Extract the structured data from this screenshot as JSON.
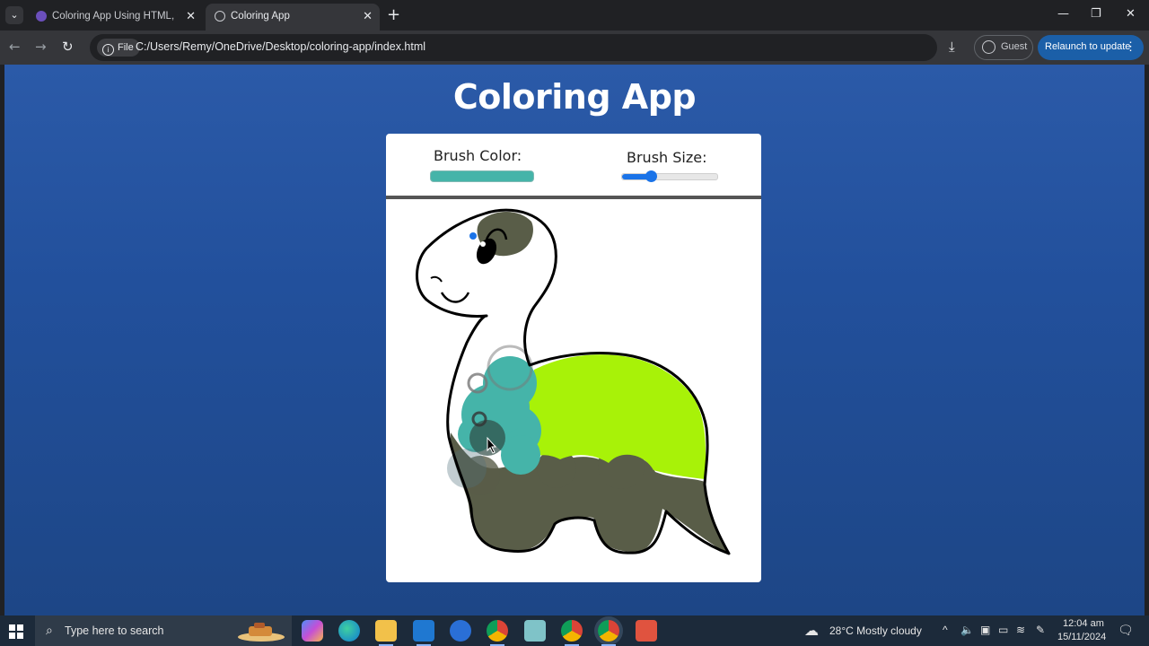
{
  "browser": {
    "tabs": [
      {
        "title": "Coloring App Using HTML, CSS",
        "favicon": "app-favicon-icon",
        "active": false
      },
      {
        "title": "Coloring App",
        "favicon": "globe-icon",
        "active": true
      }
    ],
    "new_tab_label": "+",
    "address": {
      "chip_label": "File",
      "url": "C:/Users/Remy/OneDrive/Desktop/coloring-app/index.html"
    },
    "guest_label": "Guest",
    "relaunch_label": "Relaunch to update"
  },
  "app": {
    "title": "Coloring App",
    "brush_color_label": "Brush Color:",
    "brush_color_value": "#45b4a9",
    "brush_size_label": "Brush Size:",
    "brush_size_fraction": 0.3
  },
  "colors": {
    "teal": "#45b4a9",
    "lime": "#a8f208",
    "olive": "#595d48",
    "accent_blue": "#1a73e8"
  },
  "taskbar": {
    "search_placeholder": "Type here to search",
    "apps": [
      "copilot-icon",
      "edge-icon",
      "file-explorer-icon",
      "vscode-icon",
      "app-store-icon",
      "chrome-icon",
      "notepad-icon",
      "chrome-icon",
      "chrome-icon",
      "code-editor-icon"
    ],
    "weather": "28°C  Mostly cloudy",
    "time": "12:04 am",
    "date": "15/11/2024"
  }
}
